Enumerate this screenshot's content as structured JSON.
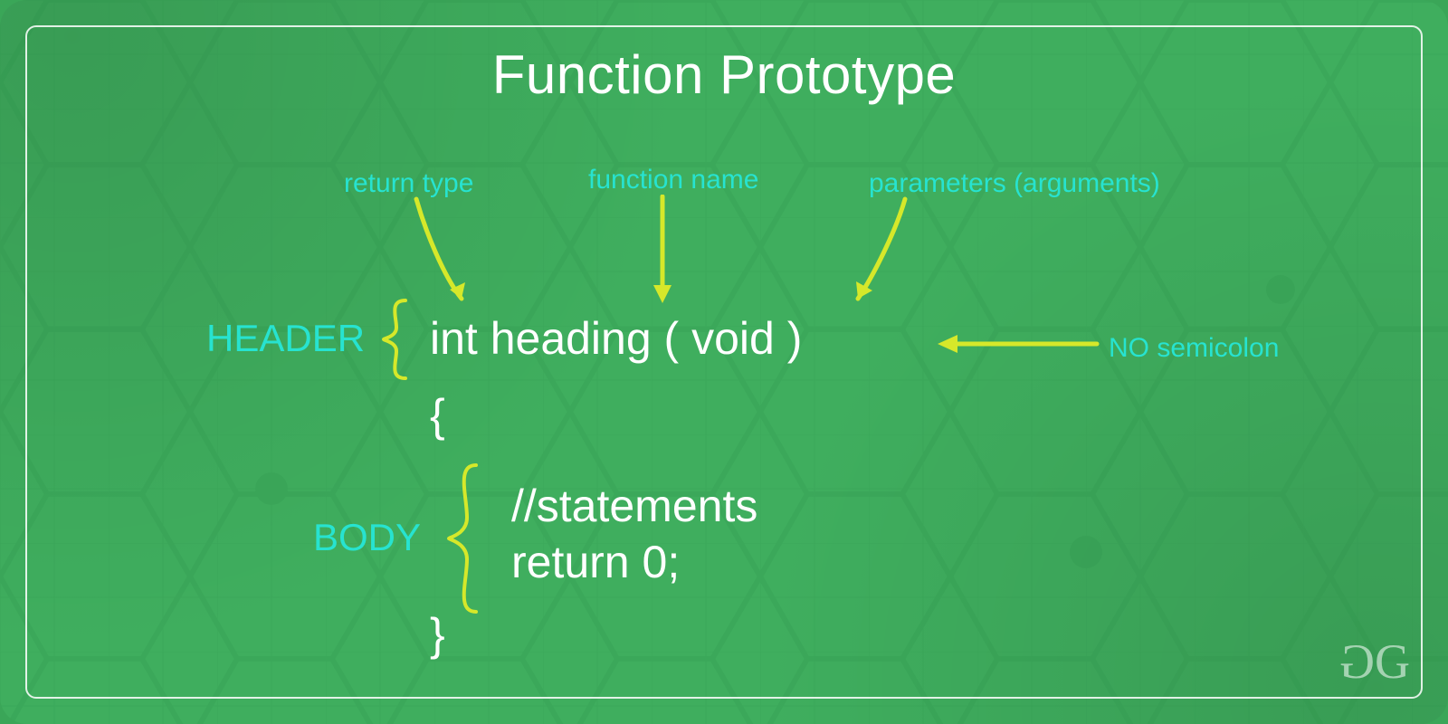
{
  "title": "Function Prototype",
  "annotations": {
    "return_type": "return type",
    "function_name": "function name",
    "parameters": "parameters (arguments)",
    "no_semicolon": "NO semicolon"
  },
  "labels": {
    "header": "HEADER",
    "body": "BODY"
  },
  "code": {
    "signature": "int heading ( void )",
    "open_brace": "{",
    "line1": "//statements",
    "line2": "return 0;",
    "close_brace": "}"
  },
  "colors": {
    "bg": "#3fae5e",
    "accent_yellow": "#d6e82a",
    "accent_cyan": "#27e3d0",
    "text_white": "#ffffff"
  }
}
